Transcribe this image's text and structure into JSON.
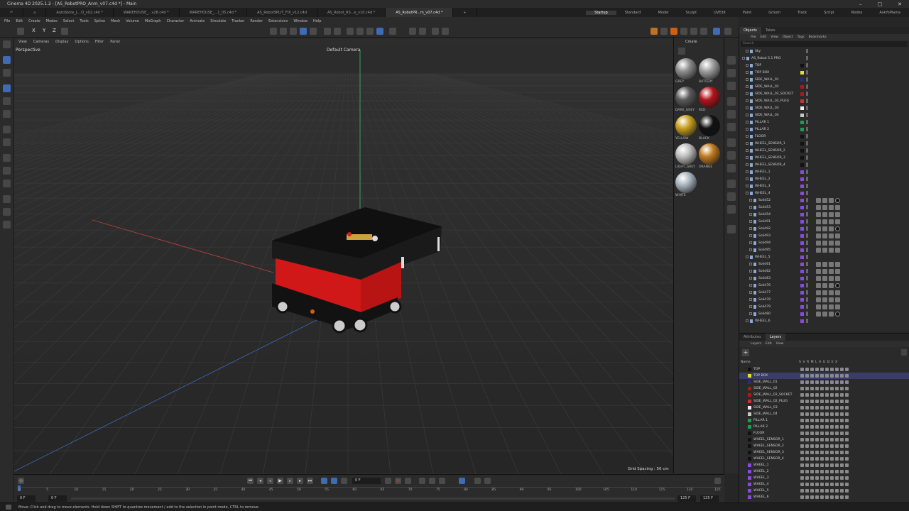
{
  "app": {
    "title": "Cinema 4D 2025.1.2 - [AS_RobotPRO_Anm_v07.c4d *] - Main"
  },
  "tabs": [
    {
      "label": "AutoStore_L...O_v02.c4d *"
    },
    {
      "label": "WAREHOUSE_...v28.c4d *"
    },
    {
      "label": "WAREHOUSE_...1_05.c4d *"
    },
    {
      "label": "AS_RobotSPLIT_FIX_v12.c4d"
    },
    {
      "label": "AS_Robot_RS...e_v10.c4d *"
    },
    {
      "label": "AS_RobotPR...m_v07.c4d *"
    }
  ],
  "layouts": [
    "Startup",
    "Standard",
    "Model",
    "Sculpt",
    "UVEdit",
    "Paint",
    "Groom",
    "Track",
    "Script",
    "Nodes",
    "AskYoMama"
  ],
  "menu": [
    "File",
    "Edit",
    "Create",
    "Modes",
    "Select",
    "Tools",
    "Spline",
    "Mesh",
    "Volume",
    "MoGraph",
    "Character",
    "Animate",
    "Simulate",
    "Tracker",
    "Render",
    "Extensions",
    "Window",
    "Help"
  ],
  "toolbar": {
    "axes": [
      "X",
      "Y",
      "Z"
    ]
  },
  "viewport": {
    "menu": [
      "View",
      "Cameras",
      "Display",
      "Options",
      "Filter",
      "Panel"
    ],
    "label": "Perspective",
    "camera": "Default Camera",
    "grid_spacing": "Grid Spacing : 50 cm"
  },
  "materials": {
    "create_label": "Create",
    "items": [
      {
        "name": "GREY",
        "color": "#8c8c8c"
      },
      {
        "name": "BATTERY",
        "color": "#9e9e9e"
      },
      {
        "name": "DARK_GREY",
        "color": "#5a5a5a"
      },
      {
        "name": "RED",
        "color": "#b0141c"
      },
      {
        "name": "YELLOW",
        "color": "#c8a020"
      },
      {
        "name": "BLACK",
        "color": "#111111"
      },
      {
        "name": "LIGHT_GREY",
        "color": "#bdbdbd"
      },
      {
        "name": "ORANGE",
        "color": "#c07a20"
      },
      {
        "name": "WHITE",
        "color": "#a9b6bf"
      }
    ]
  },
  "objects": {
    "tabs": [
      "Objects",
      "Takes"
    ],
    "menu": [
      "File",
      "Edit",
      "View",
      "Object",
      "Tags",
      "Bookmarks"
    ],
    "search": "Search",
    "rows": [
      {
        "name": "Sky",
        "color": "",
        "indent": 1
      },
      {
        "name": "AS_Robot 5.1 PRO",
        "color": "",
        "indent": 0
      },
      {
        "name": "TOP",
        "color": "#111111",
        "indent": 1
      },
      {
        "name": "TOP BOX",
        "color": "#e6e02a",
        "indent": 1
      },
      {
        "name": "SIDE_WALL_01",
        "color": "#2a2a8a",
        "indent": 1
      },
      {
        "name": "SIDE_WALL_02",
        "color": "#b01818",
        "indent": 1
      },
      {
        "name": "SIDE_WALL_02_SOCKET",
        "color": "#b01818",
        "indent": 1
      },
      {
        "name": "SIDE_WALL_02_PLUG",
        "color": "#d03030",
        "indent": 1
      },
      {
        "name": "SIDE_WALL_03",
        "color": "#eeeeee",
        "indent": 1
      },
      {
        "name": "SIDE_WALL_04",
        "color": "#c8c8c8",
        "indent": 1
      },
      {
        "name": "PILLAR 1",
        "color": "#18a050",
        "indent": 1
      },
      {
        "name": "PILLAR 2",
        "color": "#18a050",
        "indent": 1
      },
      {
        "name": "FLOOR",
        "color": "#111111",
        "indent": 1
      },
      {
        "name": "WHEEL_SENSOR_1",
        "color": "#111111",
        "indent": 1
      },
      {
        "name": "WHEEL_SENSOR_2",
        "color": "#111111",
        "indent": 1
      },
      {
        "name": "WHEEL_SENSOR_3",
        "color": "#111111",
        "indent": 1
      },
      {
        "name": "WHEEL_SENSOR_4",
        "color": "#111111",
        "indent": 1
      },
      {
        "name": "WHEEL_1",
        "color": "#8a4ae0",
        "indent": 1
      },
      {
        "name": "WHEEL_2",
        "color": "#8a4ae0",
        "indent": 1
      },
      {
        "name": "WHEEL_3",
        "color": "#8a4ae0",
        "indent": 1
      },
      {
        "name": "WHEEL_4",
        "color": "#8a4ae0",
        "indent": 1
      },
      {
        "name": "Solid52",
        "color": "#8a4ae0",
        "indent": 2,
        "tags": true
      },
      {
        "name": "Solid53",
        "color": "#8a4ae0",
        "indent": 2,
        "tags": true
      },
      {
        "name": "Solid54",
        "color": "#8a4ae0",
        "indent": 2,
        "tags": true
      },
      {
        "name": "Solid91",
        "color": "#8a4ae0",
        "indent": 2,
        "tags": true
      },
      {
        "name": "Solid92",
        "color": "#8a4ae0",
        "indent": 2,
        "tags": true
      },
      {
        "name": "Solid93",
        "color": "#8a4ae0",
        "indent": 2,
        "tags": true
      },
      {
        "name": "Solid94",
        "color": "#8a4ae0",
        "indent": 2,
        "tags": true
      },
      {
        "name": "Solid95",
        "color": "#8a4ae0",
        "indent": 2,
        "tags": true
      },
      {
        "name": "WHEEL_5",
        "color": "#8a4ae0",
        "indent": 1
      },
      {
        "name": "Solid61",
        "color": "#8a4ae0",
        "indent": 2,
        "tags": true
      },
      {
        "name": "Solid62",
        "color": "#8a4ae0",
        "indent": 2,
        "tags": true
      },
      {
        "name": "Solid63",
        "color": "#8a4ae0",
        "indent": 2,
        "tags": true
      },
      {
        "name": "Solid76",
        "color": "#8a4ae0",
        "indent": 2,
        "tags": true
      },
      {
        "name": "Solid77",
        "color": "#8a4ae0",
        "indent": 2,
        "tags": true
      },
      {
        "name": "Solid78",
        "color": "#8a4ae0",
        "indent": 2,
        "tags": true
      },
      {
        "name": "Solid79",
        "color": "#8a4ae0",
        "indent": 2,
        "tags": true
      },
      {
        "name": "Solid80",
        "color": "#8a4ae0",
        "indent": 2,
        "tags": true
      },
      {
        "name": "WHEEL_6",
        "color": "#8a4ae0",
        "indent": 1
      }
    ]
  },
  "layers": {
    "tabs": [
      "Attributes",
      "Layers"
    ],
    "menu": [
      "Layers",
      "Edit",
      "View"
    ],
    "name_header": "Name",
    "flags": "S V R M L A G D E X",
    "rows": [
      {
        "name": "TOP",
        "color": "#111111"
      },
      {
        "name": "TOP BOX",
        "color": "#e6e02a",
        "selected": true
      },
      {
        "name": "SIDE_WALL_01",
        "color": "#2a2a8a"
      },
      {
        "name": "SIDE_WALL_02",
        "color": "#b01818"
      },
      {
        "name": "SIDE_WALL_02_SOCKET",
        "color": "#b01818"
      },
      {
        "name": "SIDE_WALL_02_PLUG",
        "color": "#d03030"
      },
      {
        "name": "SIDE_WALL_03",
        "color": "#eeeeee"
      },
      {
        "name": "SIDE_WALL_04",
        "color": "#c8c8c8"
      },
      {
        "name": "PILLAR 1",
        "color": "#18a050"
      },
      {
        "name": "PILLAR 2",
        "color": "#18a050"
      },
      {
        "name": "FLOOR",
        "color": "#111111"
      },
      {
        "name": "WHEEL_SENSOR_1",
        "color": "#111111"
      },
      {
        "name": "WHEEL_SENSOR_2",
        "color": "#111111"
      },
      {
        "name": "WHEEL_SENSOR_3",
        "color": "#111111"
      },
      {
        "name": "WHEEL_SENSOR_4",
        "color": "#111111"
      },
      {
        "name": "WHEEL_1",
        "color": "#8a4ae0"
      },
      {
        "name": "WHEEL_2",
        "color": "#8a4ae0"
      },
      {
        "name": "WHEEL_3",
        "color": "#8a4ae0"
      },
      {
        "name": "WHEEL_4",
        "color": "#8a4ae0"
      },
      {
        "name": "WHEEL_5",
        "color": "#8a4ae0"
      },
      {
        "name": "WHEEL_6",
        "color": "#8a4ae0"
      }
    ]
  },
  "timeline": {
    "current_frame": "0 F",
    "start": "0 F",
    "start2": "0 F",
    "end": "125 F",
    "end2": "125 F",
    "ruler": [
      "0",
      "5",
      "10",
      "15",
      "20",
      "25",
      "30",
      "35",
      "40",
      "45",
      "50",
      "55",
      "60",
      "65",
      "70",
      "75",
      "80",
      "85",
      "90",
      "95",
      "100",
      "105",
      "110",
      "115",
      "120",
      "125"
    ]
  },
  "status": "Move: Click and drag to move elements. Hold down SHIFT to quantize movement / add to the selection in point mode, CTRL to remove."
}
